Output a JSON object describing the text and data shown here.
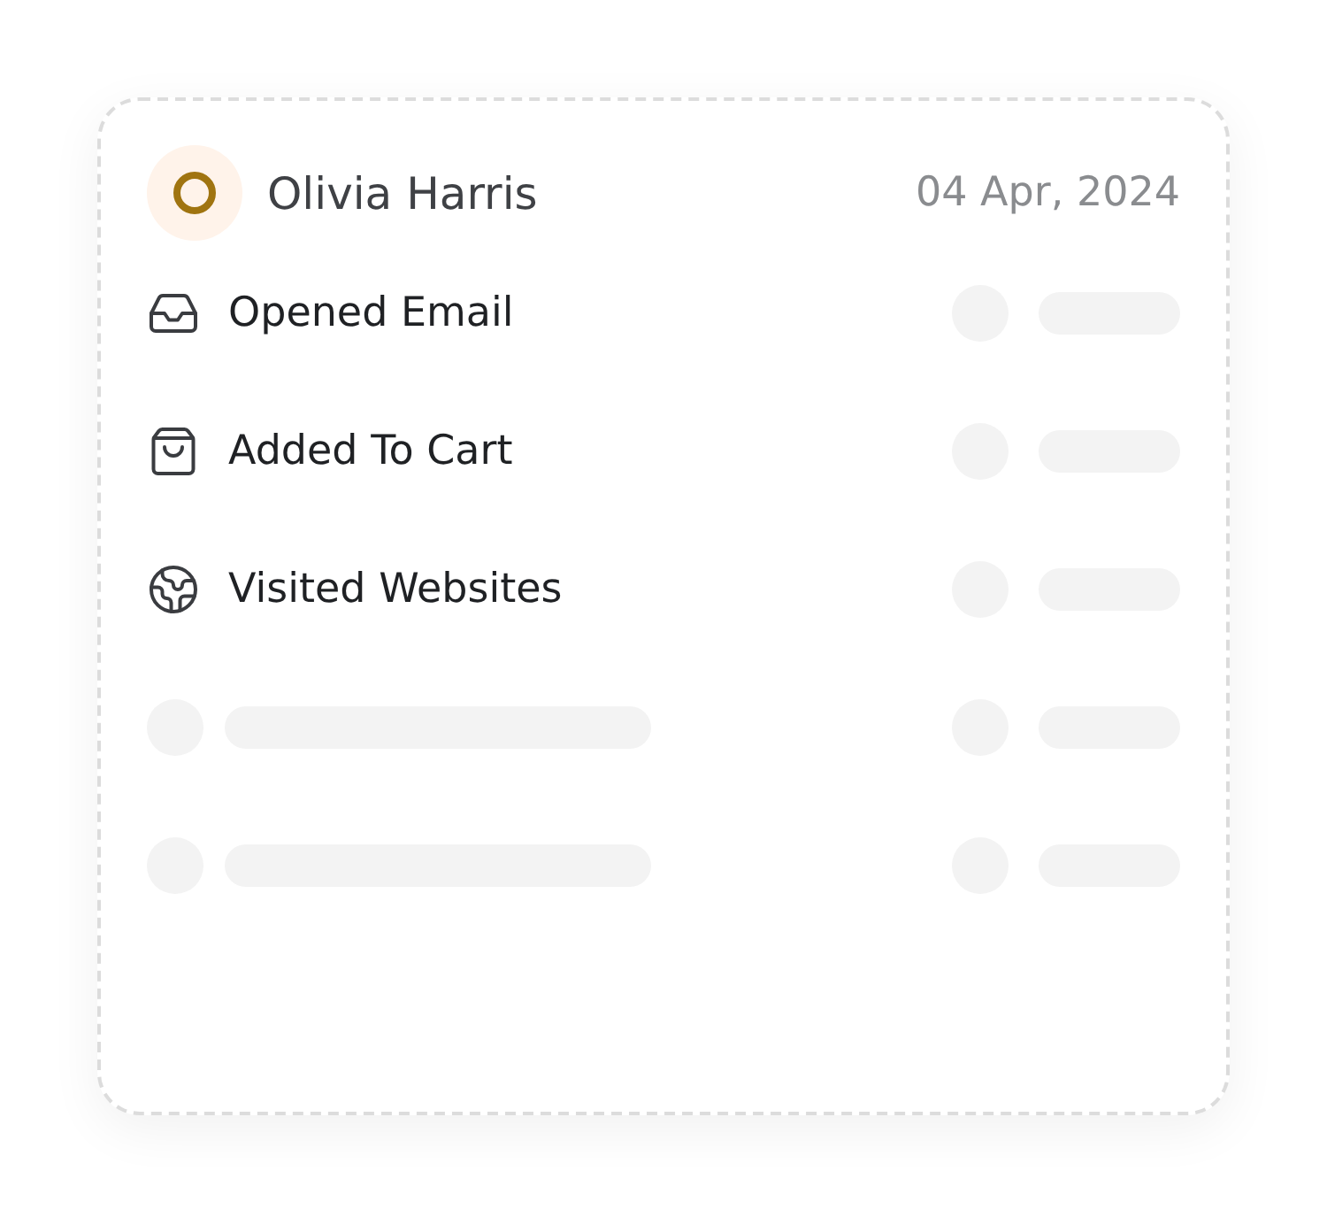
{
  "header": {
    "name": "Olivia Harris",
    "date": "04 Apr, 2024"
  },
  "rows": [
    {
      "kind": "activity",
      "label": "Opened Email"
    },
    {
      "kind": "activity",
      "label": "Added To Cart"
    },
    {
      "kind": "activity",
      "label": "Visited Websites"
    },
    {
      "kind": "placeholder"
    },
    {
      "kind": "placeholder"
    }
  ]
}
